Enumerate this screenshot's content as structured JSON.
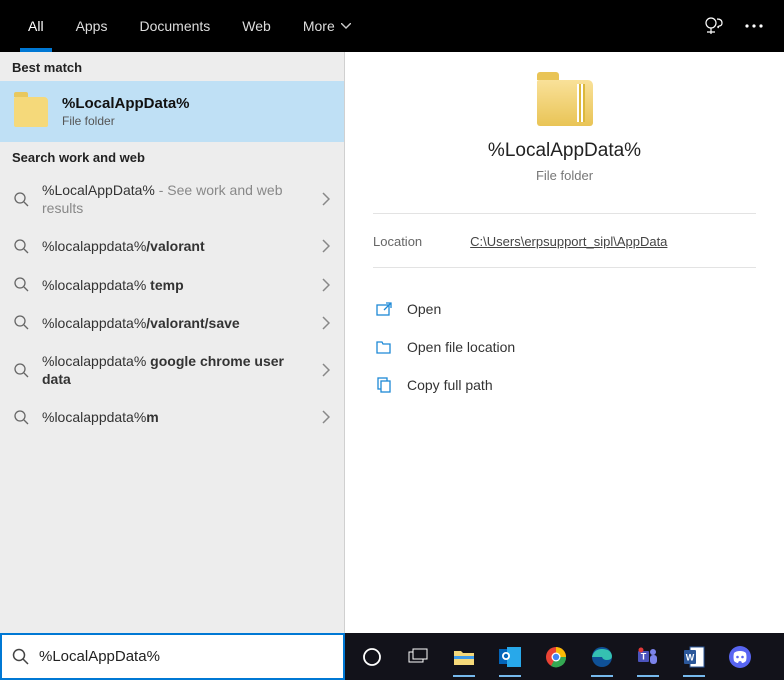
{
  "topbar": {
    "tabs": [
      "All",
      "Apps",
      "Documents",
      "Web",
      "More"
    ]
  },
  "left": {
    "best_match_header": "Best match",
    "best_match": {
      "title": "%LocalAppData%",
      "subtitle": "File folder"
    },
    "search_header": "Search work and web",
    "suggestions": [
      {
        "prefix": "%LocalAppData%",
        "suffix_light": " - See work and web results",
        "suffix_bold": ""
      },
      {
        "prefix": "%localappdata%",
        "suffix_light": "",
        "suffix_bold": "/valorant"
      },
      {
        "prefix": "%localappdata%",
        "suffix_light": "",
        "suffix_bold": " temp"
      },
      {
        "prefix": "%localappdata%",
        "suffix_light": "",
        "suffix_bold": "/valorant/save"
      },
      {
        "prefix": "%localappdata%",
        "suffix_light": "",
        "suffix_bold": " google chrome user data"
      },
      {
        "prefix": "%localappdata%",
        "suffix_light": "",
        "suffix_bold": "m"
      }
    ]
  },
  "right": {
    "title": "%LocalAppData%",
    "subtitle": "File folder",
    "location_label": "Location",
    "location_value": "C:\\Users\\erpsupport_sipl\\AppData",
    "actions": [
      "Open",
      "Open file location",
      "Copy full path"
    ]
  },
  "search": {
    "value": "%LocalAppData%"
  }
}
